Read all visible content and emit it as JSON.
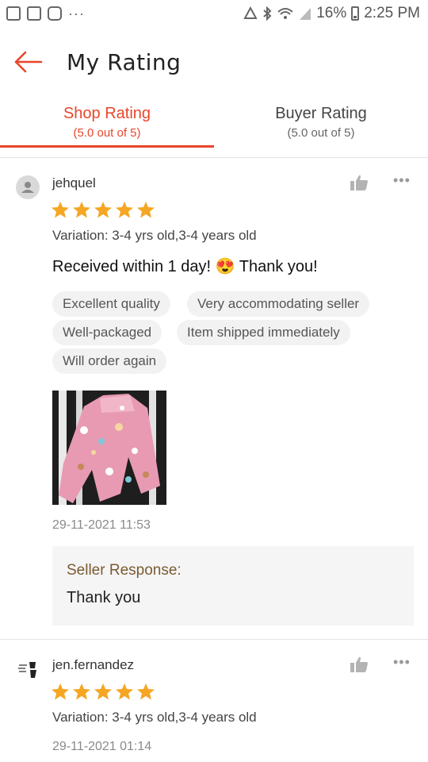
{
  "status_bar": {
    "battery": "16%",
    "time": "2:25 PM"
  },
  "header": {
    "title": "My Rating"
  },
  "tabs": [
    {
      "label": "Shop Rating",
      "sub": "(5.0 out of 5)",
      "active": true
    },
    {
      "label": "Buyer Rating",
      "sub": "(5.0 out of 5)",
      "active": false
    }
  ],
  "reviews": [
    {
      "username": "jehquel",
      "stars": 5,
      "variation": "Variation: 3-4 yrs old,3-4 years old",
      "comment": "Received within 1 day! 😍 Thank you! ",
      "tags": [
        "Excellent quality",
        "Very accommodating seller",
        "Well-packaged",
        "Item shipped immediately",
        "Will order again"
      ],
      "timestamp": "29-11-2021 11:53",
      "seller_response_label": "Seller Response:",
      "seller_response": "Thank you"
    },
    {
      "username": "jen.fernandez",
      "stars": 5,
      "variation": "Variation: 3-4 yrs old,3-4 years old",
      "timestamp": "29-11-2021 01:14"
    }
  ],
  "colors": {
    "accent": "#e8462b",
    "star": "#f5a623",
    "response_label": "#7a5a32"
  },
  "icons": {
    "back": "arrow-left-icon",
    "like": "thumbs-up-icon",
    "more": "more-dots-icon",
    "star": "star-icon"
  }
}
